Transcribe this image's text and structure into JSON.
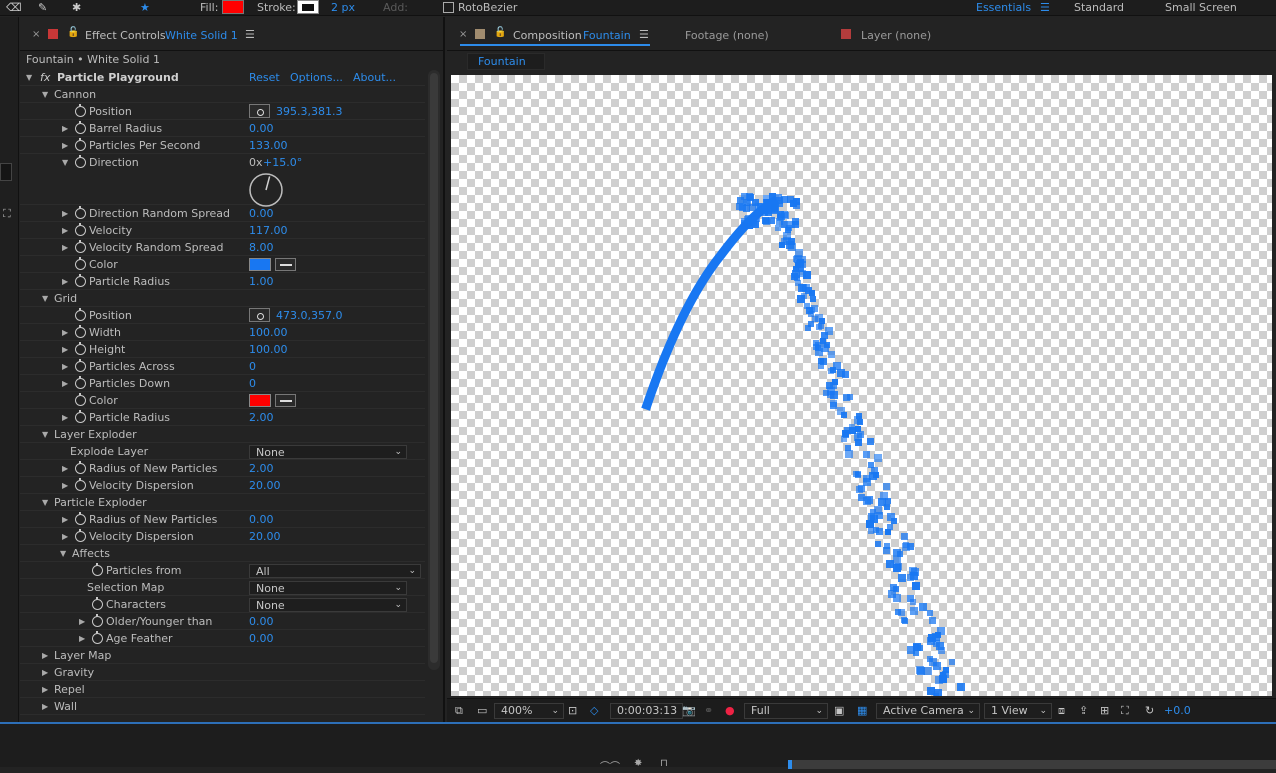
{
  "toolbar": {
    "fill_label": "Fill:",
    "fill_color": "#ff0000",
    "stroke_label": "Stroke:",
    "stroke_width": "2 px",
    "add_label": "Add:",
    "rotobezier_label": "RotoBezier",
    "workspaces": [
      "Essentials",
      "Standard",
      "Small Screen"
    ]
  },
  "effect_controls": {
    "tab_prefix": "Effect Controls",
    "tab_layer": "White Solid 1",
    "breadcrumb": "Fountain • White Solid 1",
    "effect_name": "Particle Playground",
    "reset": "Reset",
    "options": "Options...",
    "about": "About...",
    "rows": [
      {
        "label": "Cannon",
        "kind": "group",
        "level": 1,
        "open": true
      },
      {
        "label": "Position",
        "kind": "point",
        "level": 2,
        "value": "395.3,381.3"
      },
      {
        "label": "Barrel Radius",
        "kind": "num",
        "level": 2,
        "value": "0.00"
      },
      {
        "label": "Particles Per Second",
        "kind": "num",
        "level": 2,
        "value": "133.00"
      },
      {
        "label": "Direction",
        "kind": "angle",
        "level": 2,
        "open": true,
        "value_rev": "0x",
        "value_deg": "+15.0°"
      },
      {
        "label": "Direction Random Spread",
        "kind": "num",
        "level": 2,
        "value": "0.00"
      },
      {
        "label": "Velocity",
        "kind": "num",
        "level": 2,
        "value": "117.00"
      },
      {
        "label": "Velocity Random Spread",
        "kind": "num",
        "level": 2,
        "value": "8.00"
      },
      {
        "label": "Color",
        "kind": "color",
        "level": 2,
        "color": "#1877f2"
      },
      {
        "label": "Particle Radius",
        "kind": "num",
        "level": 2,
        "value": "1.00"
      },
      {
        "label": "Grid",
        "kind": "group",
        "level": 1,
        "open": true
      },
      {
        "label": "Position",
        "kind": "point",
        "level": 2,
        "value": "473.0,357.0"
      },
      {
        "label": "Width",
        "kind": "num",
        "level": 2,
        "value": "100.00"
      },
      {
        "label": "Height",
        "kind": "num",
        "level": 2,
        "value": "100.00"
      },
      {
        "label": "Particles Across",
        "kind": "num",
        "level": 2,
        "value": "0"
      },
      {
        "label": "Particles Down",
        "kind": "num",
        "level": 2,
        "value": "0"
      },
      {
        "label": "Color",
        "kind": "color",
        "level": 2,
        "color": "#ff0000"
      },
      {
        "label": "Particle Radius",
        "kind": "num",
        "level": 2,
        "value": "2.00"
      },
      {
        "label": "Layer Exploder",
        "kind": "group",
        "level": 1,
        "open": true
      },
      {
        "label": "Explode Layer",
        "kind": "select",
        "level": 2,
        "value": "None"
      },
      {
        "label": "Radius of New Particles",
        "kind": "num",
        "level": 2,
        "value": "2.00"
      },
      {
        "label": "Velocity Dispersion",
        "kind": "num",
        "level": 2,
        "value": "20.00"
      },
      {
        "label": "Particle Exploder",
        "kind": "group",
        "level": 1,
        "open": true
      },
      {
        "label": "Radius of New Particles",
        "kind": "num",
        "level": 2,
        "value": "0.00"
      },
      {
        "label": "Velocity Dispersion",
        "kind": "num",
        "level": 2,
        "value": "20.00"
      },
      {
        "label": "Affects",
        "kind": "group",
        "level": 2,
        "open": true
      },
      {
        "label": "Particles from",
        "kind": "select",
        "level": 3,
        "value": "All"
      },
      {
        "label": "Selection Map",
        "kind": "select",
        "level": 3,
        "value": "None"
      },
      {
        "label": "Characters",
        "kind": "select",
        "level": 3,
        "value": "None"
      },
      {
        "label": "Older/Younger than",
        "kind": "num",
        "level": 3,
        "value": "0.00"
      },
      {
        "label": "Age Feather",
        "kind": "num",
        "level": 3,
        "value": "0.00"
      },
      {
        "label": "Layer Map",
        "kind": "group",
        "level": 1,
        "open": false
      },
      {
        "label": "Gravity",
        "kind": "group",
        "level": 1,
        "open": false
      },
      {
        "label": "Repel",
        "kind": "group",
        "level": 1,
        "open": false
      },
      {
        "label": "Wall",
        "kind": "group",
        "level": 1,
        "open": false
      }
    ]
  },
  "composition": {
    "tab_prefix": "Composition",
    "tab_name": "Fountain",
    "footage_tab": "Footage (none)",
    "layer_tab": "Layer (none)",
    "subtab": "Fountain",
    "particle_color": "#1877f2"
  },
  "viewer_bar": {
    "zoom": "400%",
    "timecode": "0:00:03:13",
    "resolution": "Full",
    "camera": "Active Camera",
    "views": "1 View",
    "exposure": "+0.0"
  }
}
